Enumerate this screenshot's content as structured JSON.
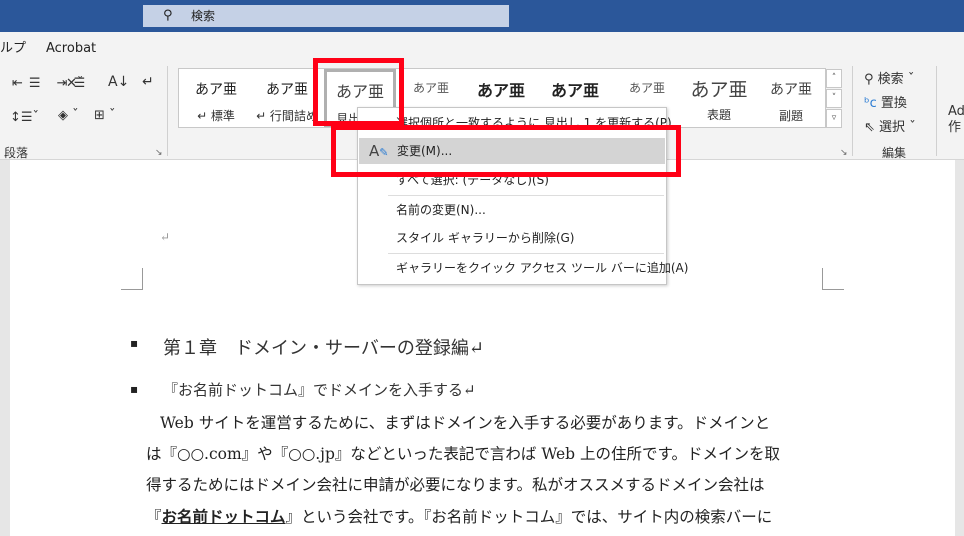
{
  "titlebar": {
    "search_placeholder": "検索",
    "search_icon": "search-icon"
  },
  "menubar": {
    "items": [
      "ルプ",
      "Acrobat"
    ]
  },
  "ribbon": {
    "paragraph_group_label": "段落",
    "styles": [
      {
        "preview": "あア亜",
        "label": "↵ 標準"
      },
      {
        "preview": "あア亜",
        "label": "↵ 行間詰め"
      },
      {
        "preview": "あア亜",
        "label": "見出し 1",
        "selected": true
      },
      {
        "preview": "あア亜",
        "label": ""
      },
      {
        "preview": "あア亜",
        "label": ""
      },
      {
        "preview": "あア亜",
        "label": ""
      },
      {
        "preview": "あア亜",
        "label": ""
      },
      {
        "preview": "あア亜",
        "label": "表題"
      },
      {
        "preview": "あア亜",
        "label": "副題"
      }
    ],
    "editing": {
      "find": "検索",
      "replace": "置換",
      "select": "選択",
      "group_label": "編集"
    },
    "addin": {
      "line1": "Ad",
      "line2": "作"
    }
  },
  "context_menu": {
    "items": [
      "選択個所と一致するように 見出し 1 を更新する(P)",
      "変更(M)...",
      "すべて選択: (データなし)(S)",
      "名前の変更(N)...",
      "スタイル ギャラリーから削除(G)",
      "ギャラリーをクイック アクセス ツール バーに追加(A)"
    ],
    "highlighted": "変更(M)..."
  },
  "document": {
    "return_mark": "↵",
    "heading1": "第１章　ドメイン・サーバーの登録編↵",
    "heading2": "『お名前ドットコム』でドメインを入手する↵",
    "lines": [
      "Web サイトを運営するために、まずはドメインを入手する必要があります。ドメインと",
      "は『○○.com』や『○○.jp』などといった表記で言わば Web 上の住所です。ドメインを取",
      "得するためにはドメイン会社に申請が必要になります。私がオススメするドメイン会社は"
    ],
    "last_line_bold": "お名前ドットコム",
    "last_line_pre": "『",
    "last_line_post": "』という会社です。『お名前ドットコム』では、サイト内の検索バーに"
  },
  "colors": {
    "titlebar": "#2b579a",
    "highlight_box": "#ff0016",
    "menu_hover": "#d4d4d4"
  }
}
